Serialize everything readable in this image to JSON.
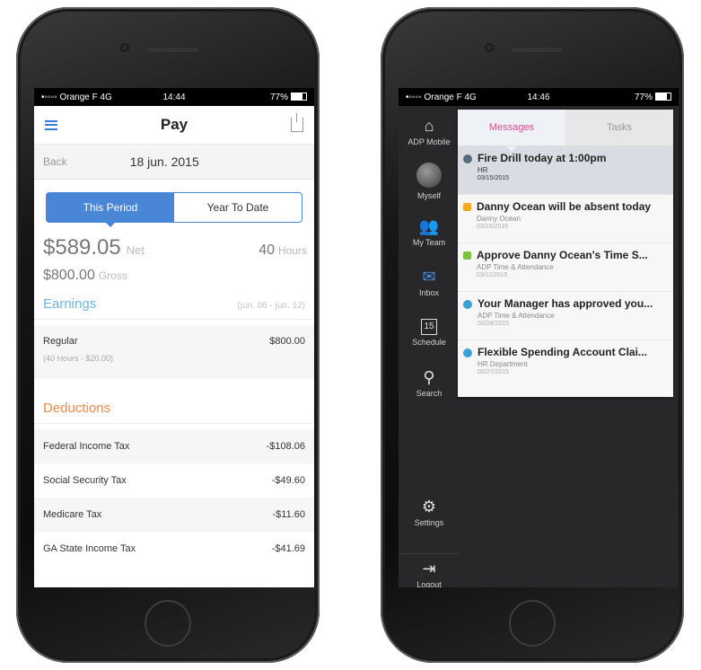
{
  "left_phone": {
    "status": {
      "carrier": "•◦◦◦◦ Orange F  4G",
      "time": "14:44",
      "battery": "77%"
    },
    "nav": {
      "title": "Pay"
    },
    "datebar": {
      "back": "Back",
      "date": "18 jun. 2015"
    },
    "segment": {
      "this_period": "This Period",
      "year_to_date": "Year To Date"
    },
    "summary": {
      "net_amount": "$589.05",
      "net_label": "Net",
      "hours": "40",
      "hours_label": "Hours",
      "gross_amount": "$800.00",
      "gross_label": "Gross"
    },
    "earnings": {
      "header": "Earnings",
      "range": "(jun. 06 - jun. 12)",
      "rows": [
        {
          "label": "Regular",
          "sub": "(40 Hours - $20.00)",
          "value": "$800.00"
        }
      ]
    },
    "deductions": {
      "header": "Deductions",
      "rows": [
        {
          "label": "Federal Income Tax",
          "value": "-$108.06"
        },
        {
          "label": "Social Security Tax",
          "value": "-$49.60"
        },
        {
          "label": "Medicare Tax",
          "value": "-$11.60"
        },
        {
          "label": "GA State Income Tax",
          "value": "-$41.69"
        }
      ]
    }
  },
  "right_phone": {
    "status": {
      "carrier": "•◦◦◦◦ Orange F  4G",
      "time": "14:46",
      "battery": "77%"
    },
    "sidebar": {
      "items": [
        {
          "label": "ADP Mobile",
          "icon": "home-icon"
        },
        {
          "label": "Myself",
          "icon": "avatar"
        },
        {
          "label": "My Team",
          "icon": "team-icon"
        },
        {
          "label": "Inbox",
          "icon": "mail-icon"
        },
        {
          "label": "Schedule",
          "icon": "calendar-icon",
          "day": "15"
        },
        {
          "label": "Search",
          "icon": "search-icon"
        }
      ],
      "settings": "Settings",
      "logout": "Logout"
    },
    "tabs": {
      "messages": "Messages",
      "tasks": "Tasks"
    },
    "messages": [
      {
        "title": "Fire Drill today at 1:00pm",
        "from": "HR",
        "date": "03/15/2015",
        "marker": "dot",
        "color": "#5a6b7d"
      },
      {
        "title": "Danny Ocean will be absent today",
        "from": "Danny Ocean",
        "date": "03/15/2015",
        "marker": "square",
        "color": "#f5a623"
      },
      {
        "title": "Approve Danny Ocean's Time S...",
        "from": "ADP Time & Attendance",
        "date": "03/11/2015",
        "marker": "square",
        "color": "#7cc242"
      },
      {
        "title": "Your Manager has approved you...",
        "from": "ADP Time & Attendance",
        "date": "02/28/2015",
        "marker": "dot",
        "color": "#3aa0d8"
      },
      {
        "title": "Flexible Spending Account Clai...",
        "from": "HR Department",
        "date": "02/27/2015",
        "marker": "dot",
        "color": "#3aa0d8"
      }
    ]
  },
  "colors": {
    "blue": "#4a86d6",
    "earnings": "#6cb6e4",
    "deductions": "#f0884a",
    "messages_tab": "#d94d8f"
  }
}
